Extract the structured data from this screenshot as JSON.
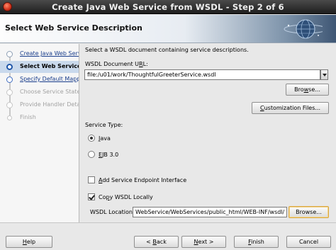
{
  "window": {
    "title": "Create Java Web Service from WSDL - Step 2 of 6"
  },
  "header": {
    "title": "Select Web Service Description"
  },
  "steps": [
    {
      "label": "Create Java Web Servic",
      "state": "done"
    },
    {
      "label": "Select Web Service D",
      "state": "current"
    },
    {
      "label": "Specify Default Mappi",
      "state": "link"
    },
    {
      "label": "Choose Service State",
      "state": "disabled"
    },
    {
      "label": "Provide Handler Detai",
      "state": "disabled"
    },
    {
      "label": "Finish",
      "state": "disabled"
    }
  ],
  "main": {
    "instruction": "Select a WSDL document containing service descriptions.",
    "wsdl_url_label": "WSDL Document URL:",
    "wsdl_url_value": "file:/u01/work/ThoughtfulGreeterService.wsdl",
    "browse_label": "Browse...",
    "customization_label": "Customization Files...",
    "service_type_label": "Service Type:",
    "java_label": "Java",
    "java_selected": true,
    "ejb_label": "EJB 3.0",
    "ejb_selected": false,
    "add_endpoint_label": "Add Service Endpoint Interface",
    "add_endpoint_checked": false,
    "copy_wsdl_label": "Copy WSDL Locally",
    "copy_wsdl_checked": true,
    "wsdl_location_label": "WSDL Location:",
    "wsdl_location_value": "WebService/WebServices/public_html/WEB-INF/wsdl/",
    "browse2_label": "Browse..."
  },
  "footer": {
    "help_label": "Help",
    "back_label": "< Back",
    "next_label": "Next >",
    "finish_label": "Finish",
    "cancel_label": "Cancel"
  },
  "colors": {
    "accent": "#1f56a8",
    "link": "#1a3e8c",
    "selection": "#c9d9ec"
  }
}
